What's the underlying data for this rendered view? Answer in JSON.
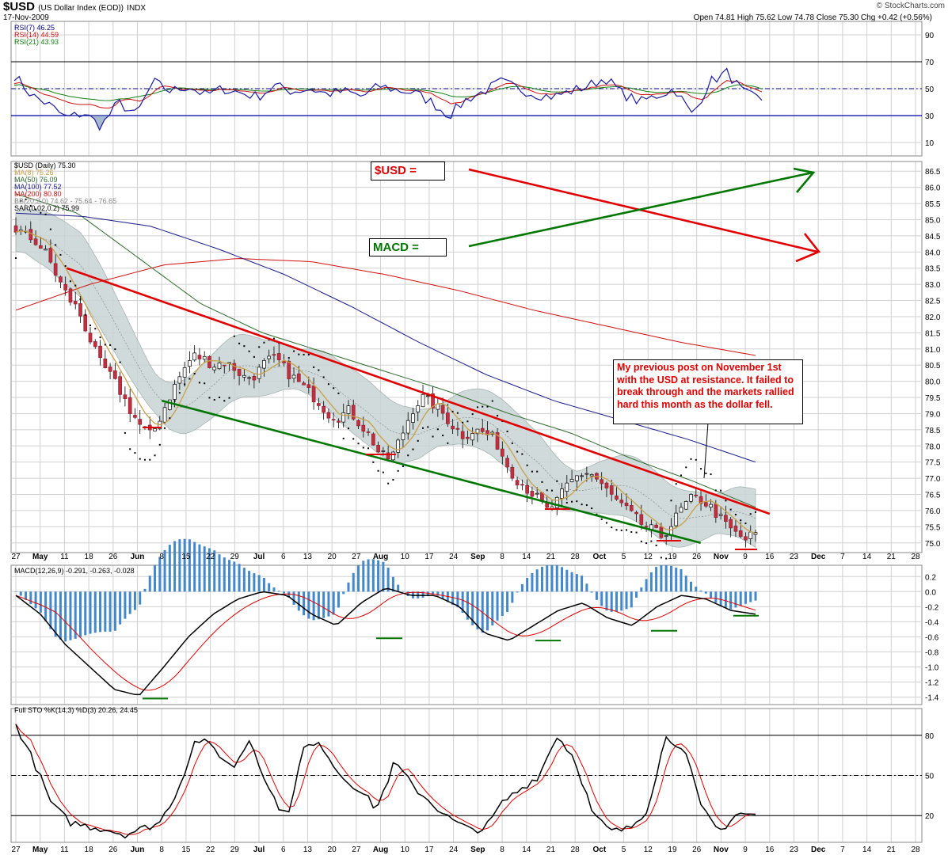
{
  "header": {
    "symbol": "$USD",
    "name": "(US Dollar Index (EOD))",
    "exchange": "INDX",
    "date": "17-Nov-2009",
    "ohlc": "Open 74.81  High 75.62  Low 74.78  Close 75.30  Chg +0.42 (+0.56%)",
    "credit": "© StockCharts.com"
  },
  "annotations": {
    "usd_label": "$USD =",
    "macd_label": "MACD =",
    "note": "My previous post on November 1st with the USD at resistance. It failed to break through and the markets rallied hard this month as the dollar fell."
  },
  "x_axis": [
    "27",
    "May",
    "11",
    "18",
    "26",
    "Jun",
    "8",
    "15",
    "22",
    "29",
    "Jul",
    "6",
    "13",
    "20",
    "27",
    "Aug",
    "10",
    "17",
    "24",
    "Sep",
    "8",
    "14",
    "21",
    "28",
    "Oct",
    "5",
    "12",
    "19",
    "26",
    "Nov",
    "9",
    "16",
    "23",
    "Dec",
    "7",
    "14",
    "21",
    "28"
  ],
  "x_axis_bold": [
    "May",
    "Jun",
    "Jul",
    "Aug",
    "Sep",
    "Oct",
    "Nov",
    "Dec"
  ],
  "colors": {
    "red": "#e00000",
    "green": "#007700",
    "navy": "#000080",
    "black": "#000000",
    "ma8": "#c8a04a",
    "ma50": "#2e6b2e",
    "ma100": "#1a1a8c",
    "ma200": "#d01010",
    "bb": "#aab8b8",
    "macd_hist": "#4488cc"
  },
  "chart_data": [
    {
      "type": "line",
      "panel": "RSI",
      "legend": [
        "RSI(7) 46.25",
        "RSI(14) 44.59",
        "RSI(21) 43.93"
      ],
      "series": [
        {
          "name": "RSI(7)",
          "last": 46.25
        },
        {
          "name": "RSI(14)",
          "last": 44.59
        },
        {
          "name": "RSI(21)",
          "last": 43.93
        }
      ],
      "y_ticks": [
        90,
        70,
        50,
        30,
        10
      ],
      "ylim": [
        0,
        100
      ],
      "reference_lines": [
        70,
        50,
        30
      ]
    },
    {
      "type": "candlestick",
      "panel": "Price",
      "legend": [
        "$USD (Daily) 75.30",
        "MA(8) 75.26",
        "MA(50) 76.09",
        "MA(100) 77.52",
        "MA(200) 80.80",
        "BB(20,2.0) 74.62 - 75.64 - 76.65",
        "SAR(0.02,0.2) 75.99"
      ],
      "y_ticks": [
        86.5,
        86.0,
        85.5,
        85.0,
        84.5,
        84.0,
        83.5,
        83.0,
        82.5,
        82.0,
        81.5,
        81.0,
        80.5,
        80.0,
        79.5,
        79.0,
        78.5,
        78.0,
        77.5,
        77.0,
        76.5,
        76.0,
        75.5,
        75.0
      ],
      "ylim": [
        74.7,
        86.8
      ],
      "close_path": [
        84.7,
        84.5,
        84.3,
        83.9,
        83.2,
        82.6,
        82.2,
        81.4,
        80.6,
        80.2,
        79.7,
        79.1,
        78.6,
        78.3,
        79.0,
        79.7,
        80.3,
        80.8,
        80.7,
        80.5,
        80.6,
        80.4,
        80.1,
        80.2,
        80.6,
        80.7,
        80.3,
        80.0,
        79.7,
        79.4,
        79.0,
        78.9,
        79.1,
        78.7,
        78.3,
        77.7,
        77.6,
        78.3,
        79.1,
        79.5,
        79.3,
        79.0,
        78.6,
        78.3,
        78.5,
        78.4,
        78.2,
        77.5,
        77.0,
        76.7,
        76.4,
        76.0,
        76.3,
        76.8,
        77.1,
        77.2,
        76.9,
        76.5,
        76.2,
        75.9,
        75.6,
        75.4,
        75.2,
        75.6,
        76.1,
        76.4,
        76.3,
        76.0,
        75.6,
        75.3,
        75.1,
        75.3
      ],
      "moving_average_last": {
        "MA(8)": 75.26,
        "MA(50)": 76.09,
        "MA(100)": 77.52,
        "MA(200)": 80.8
      },
      "bollinger_last": {
        "lower": 74.62,
        "middle": 75.64,
        "upper": 76.65
      },
      "sar_last": 75.99,
      "trendlines": [
        {
          "color": "red",
          "from": [
            83.5,
            "May 11"
          ],
          "to": [
            75.9,
            "Nov 16"
          ]
        },
        {
          "color": "green",
          "from": [
            79.4,
            "Jun 8"
          ],
          "to": [
            75.0,
            "Oct 26"
          ]
        }
      ]
    },
    {
      "type": "bar",
      "panel": "MACD",
      "legend": [
        "MACD(12,26,9) -0.291, -0.263, -0.028"
      ],
      "macd_last": -0.291,
      "signal_last": -0.263,
      "hist_last": -0.028,
      "y_ticks": [
        0.2,
        0.0,
        -0.2,
        -0.4,
        -0.6,
        -0.8,
        -1.0,
        -1.2,
        -1.4
      ],
      "ylim": [
        -1.5,
        0.35
      ]
    },
    {
      "type": "line",
      "panel": "Stochastic",
      "legend": [
        "Full STO %K(14,3) %D(3) 20.26, 24.45"
      ],
      "k_last": 20.26,
      "d_last": 24.45,
      "y_ticks": [
        80,
        50,
        20
      ],
      "ylim": [
        0,
        100
      ]
    }
  ]
}
